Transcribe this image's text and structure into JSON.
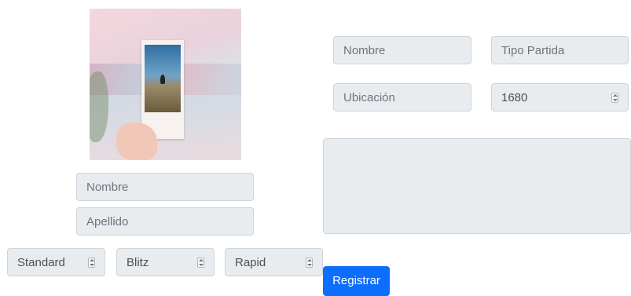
{
  "left_form": {
    "nombre_placeholder": "Nombre",
    "apellido_placeholder": "Apellido",
    "spinners": [
      {
        "value": "Standard"
      },
      {
        "value": "Blitz"
      },
      {
        "value": "Rapid"
      }
    ]
  },
  "right_form": {
    "nombre_placeholder": "Nombre",
    "tipo_partida_placeholder": "Tipo Partida",
    "ubicacion_placeholder": "Ubicación",
    "rating_value": "1680",
    "comments_value": ""
  },
  "submit_label": "Registrar",
  "icons": {
    "profile_photo": "photo-image",
    "spinner_arrows": "updown-arrows-icon"
  },
  "colors": {
    "field_bg": "#e9ecef",
    "field_border": "#ced4da",
    "placeholder": "#6c757d",
    "button_bg": "#0d6efd",
    "button_text": "#ffffff"
  }
}
